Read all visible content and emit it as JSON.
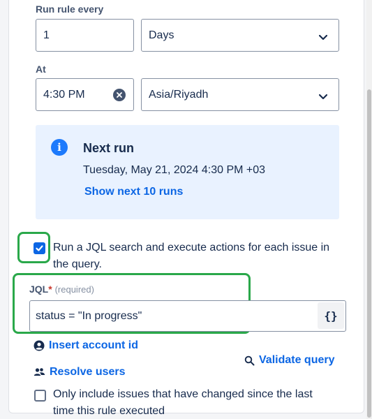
{
  "schedule": {
    "run_every_label": "Run rule every",
    "run_every_value": "1",
    "unit_value": "Days",
    "at_label": "At",
    "time_value": "4:30 PM",
    "timezone_value": "Asia/Riyadh"
  },
  "next_run": {
    "icon": "info-icon",
    "icon_glyph": "i",
    "title": "Next run",
    "datetime": "Tuesday, May 21, 2024 4:30 PM +03",
    "show_more_link": "Show next 10 runs"
  },
  "jql_option": {
    "checked": true,
    "label_line1": "Run a JQL search and execute actions for each issue in",
    "label_line2": "the query."
  },
  "jql": {
    "label": "JQL",
    "required_marker": "*",
    "required_text": "(required)",
    "value": "status = \"In progress\"",
    "braces_button": "{}"
  },
  "links": {
    "insert_account_id": "Insert account id",
    "resolve_users": "Resolve users",
    "validate_query": "Validate query"
  },
  "changed_option": {
    "checked": false,
    "label_line1": "Only include issues that have changed since the last",
    "label_line2": "time this rule executed"
  },
  "colors": {
    "accent": "#0c66e4",
    "highlight": "#2aa84a",
    "info_bg": "#e9f2ff"
  }
}
